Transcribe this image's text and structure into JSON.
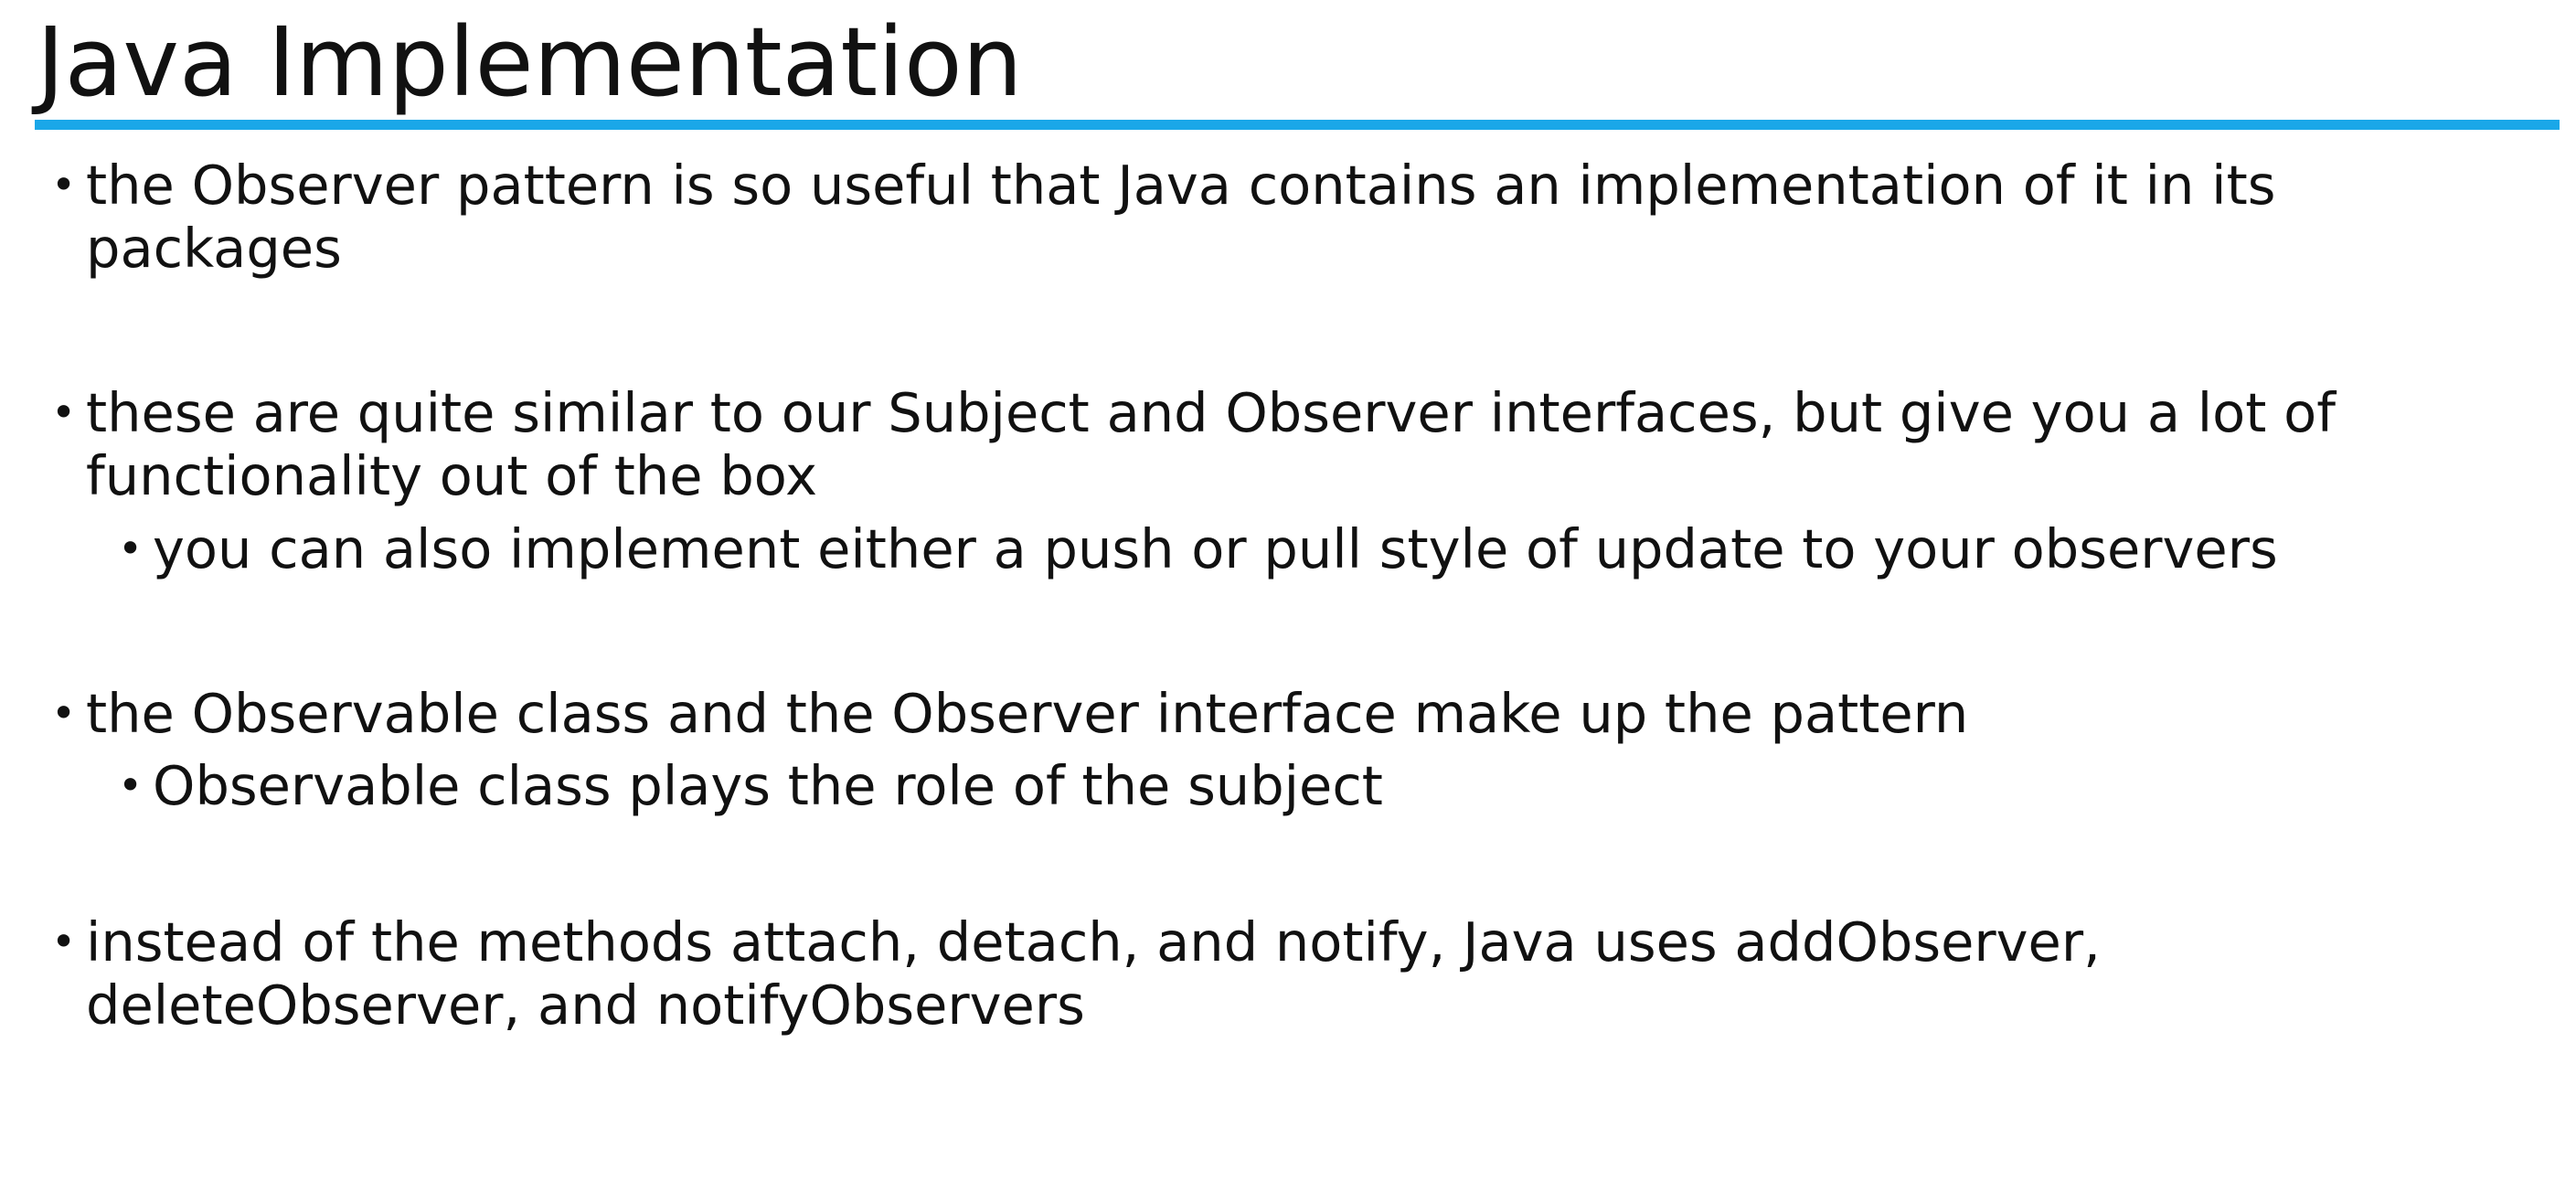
{
  "slide": {
    "title": "Java Implementation",
    "accent_color": "#1aa7e8",
    "bullet_glyph": "•",
    "bullets": [
      {
        "lines": [
          "the Observer pattern is so useful that Java contains an implementation of it in its",
          "packages"
        ]
      },
      {
        "lines": [
          "these are quite similar to our Subject and Observer interfaces, but give you a lot of",
          "functionality out of the box"
        ],
        "sub": "you can also implement either a push or pull style of update to your observers"
      },
      {
        "lines": [
          "the Observable class and the Observer interface make up the pattern"
        ],
        "sub": "Observable class plays the role of the subject"
      },
      {
        "lines": [
          "instead of the methods attach, detach, and notify, Java uses addObserver,",
          "deleteObserver, and notifyObservers"
        ]
      }
    ]
  }
}
